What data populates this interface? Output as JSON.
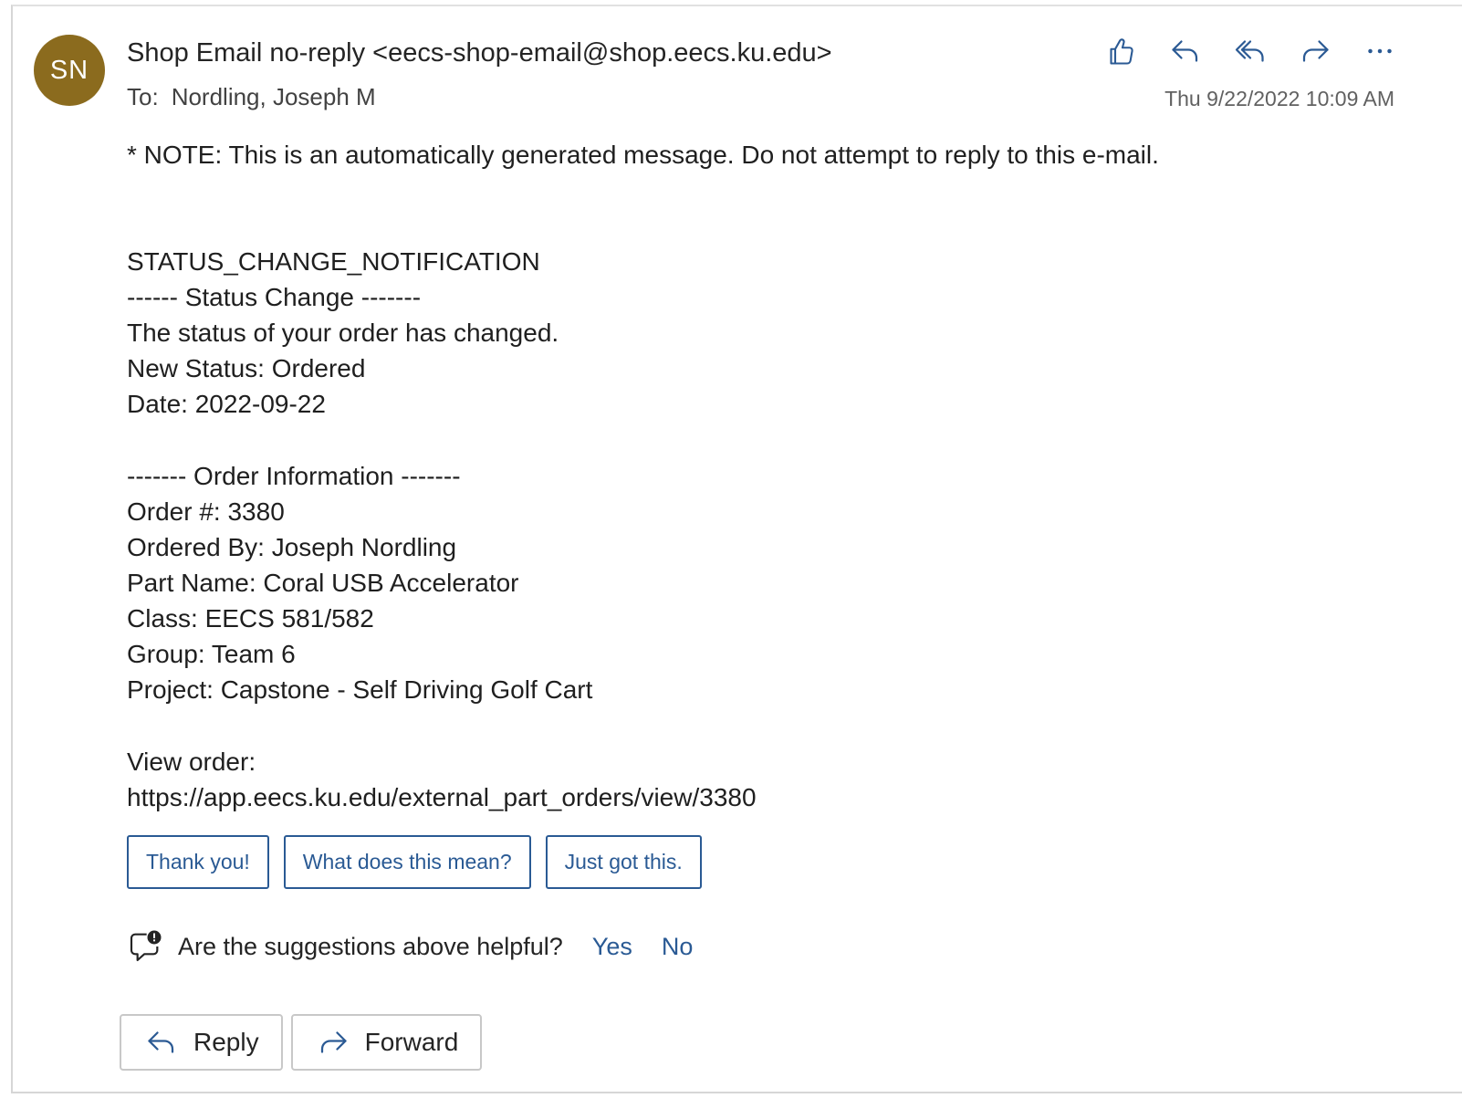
{
  "message": {
    "avatar_initials": "SN",
    "avatar_color": "#8b6b1e",
    "sender": "Shop Email no-reply <eecs-shop-email@shop.eecs.ku.edu>",
    "to_label": "To:",
    "to_value": "Nordling, Joseph M",
    "timestamp": "Thu 9/22/2022 10:09 AM"
  },
  "actions": [
    {
      "name": "like-icon"
    },
    {
      "name": "reply-icon"
    },
    {
      "name": "reply-all-icon"
    },
    {
      "name": "forward-icon"
    },
    {
      "name": "more-icon"
    }
  ],
  "body": {
    "note": "* NOTE: This is an automatically generated message. Do not attempt to reply to this e-mail.",
    "status_block": [
      "STATUS_CHANGE_NOTIFICATION",
      "------ Status Change -------",
      "The status of your order has changed.",
      "New Status: Ordered",
      "Date: 2022-09-22"
    ],
    "order_block": [
      "------- Order Information -------",
      "Order #: 3380",
      "Ordered By: Joseph Nordling",
      "Part Name: Coral USB Accelerator",
      "Class: EECS 581/582",
      "Group: Team 6",
      "Project: Capstone - Self Driving Golf Cart"
    ],
    "view_label": "View order:",
    "view_url": "https://app.eecs.ku.edu/external_part_orders/view/3380"
  },
  "suggestions": [
    "Thank you!",
    "What does this mean?",
    "Just got this."
  ],
  "feedback": {
    "question": "Are the suggestions above helpful?",
    "yes": "Yes",
    "no": "No"
  },
  "bottom": {
    "reply": "Reply",
    "forward": "Forward"
  },
  "colors": {
    "link_blue": "#2a5a94",
    "action_icon_blue": "#2b5a94"
  }
}
